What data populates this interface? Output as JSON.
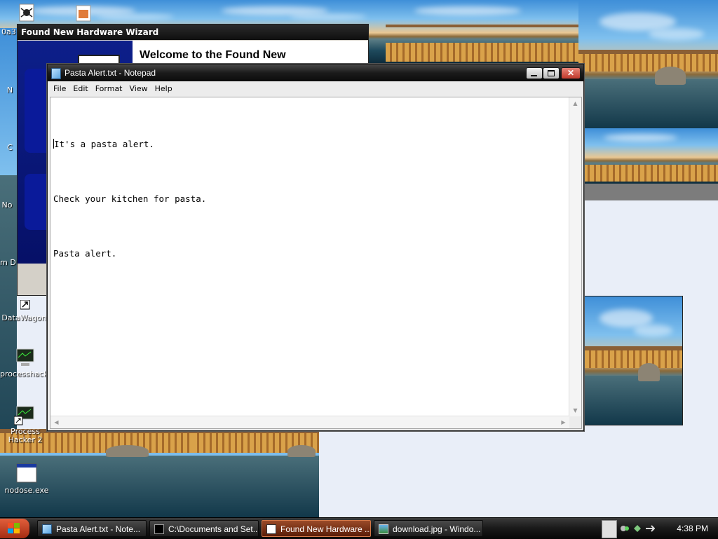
{
  "desktop": {
    "icons": [
      {
        "label": "0a3"
      },
      {
        "label": "N"
      },
      {
        "label": "C"
      },
      {
        "label": "No"
      },
      {
        "label": "Em D"
      },
      {
        "label": "DataWagon."
      },
      {
        "label": "processhack."
      },
      {
        "label": "Process Hacker 2"
      },
      {
        "label": "nodose.exe"
      }
    ]
  },
  "wizard": {
    "title": "Found New Hardware Wizard",
    "heading": "Welcome to the Found New"
  },
  "notepad": {
    "title": "Pasta Alert.txt - Notepad",
    "menu": [
      "File",
      "Edit",
      "Format",
      "View",
      "Help"
    ],
    "lines": [
      "It's a pasta alert.",
      "Check your kitchen for pasta.",
      "Pasta alert."
    ],
    "close_glyph": "✕"
  },
  "taskbar": {
    "items": [
      {
        "label": "Pasta Alert.txt - Note...",
        "icon": "notepad-icon",
        "active": false
      },
      {
        "label": "C:\\Documents and Set...",
        "icon": "cmd-icon",
        "active": false
      },
      {
        "label": "Found New Hardware ...",
        "icon": "wizard-icon",
        "active": true
      },
      {
        "label": "download.jpg - Windo...",
        "icon": "image-viewer-icon",
        "active": false
      }
    ],
    "clock": "4:38 PM"
  },
  "colors": {
    "active_task": "#9a4a28",
    "titlebar": "#1b1b1b",
    "wizard_panel": "#0d1f8a"
  }
}
